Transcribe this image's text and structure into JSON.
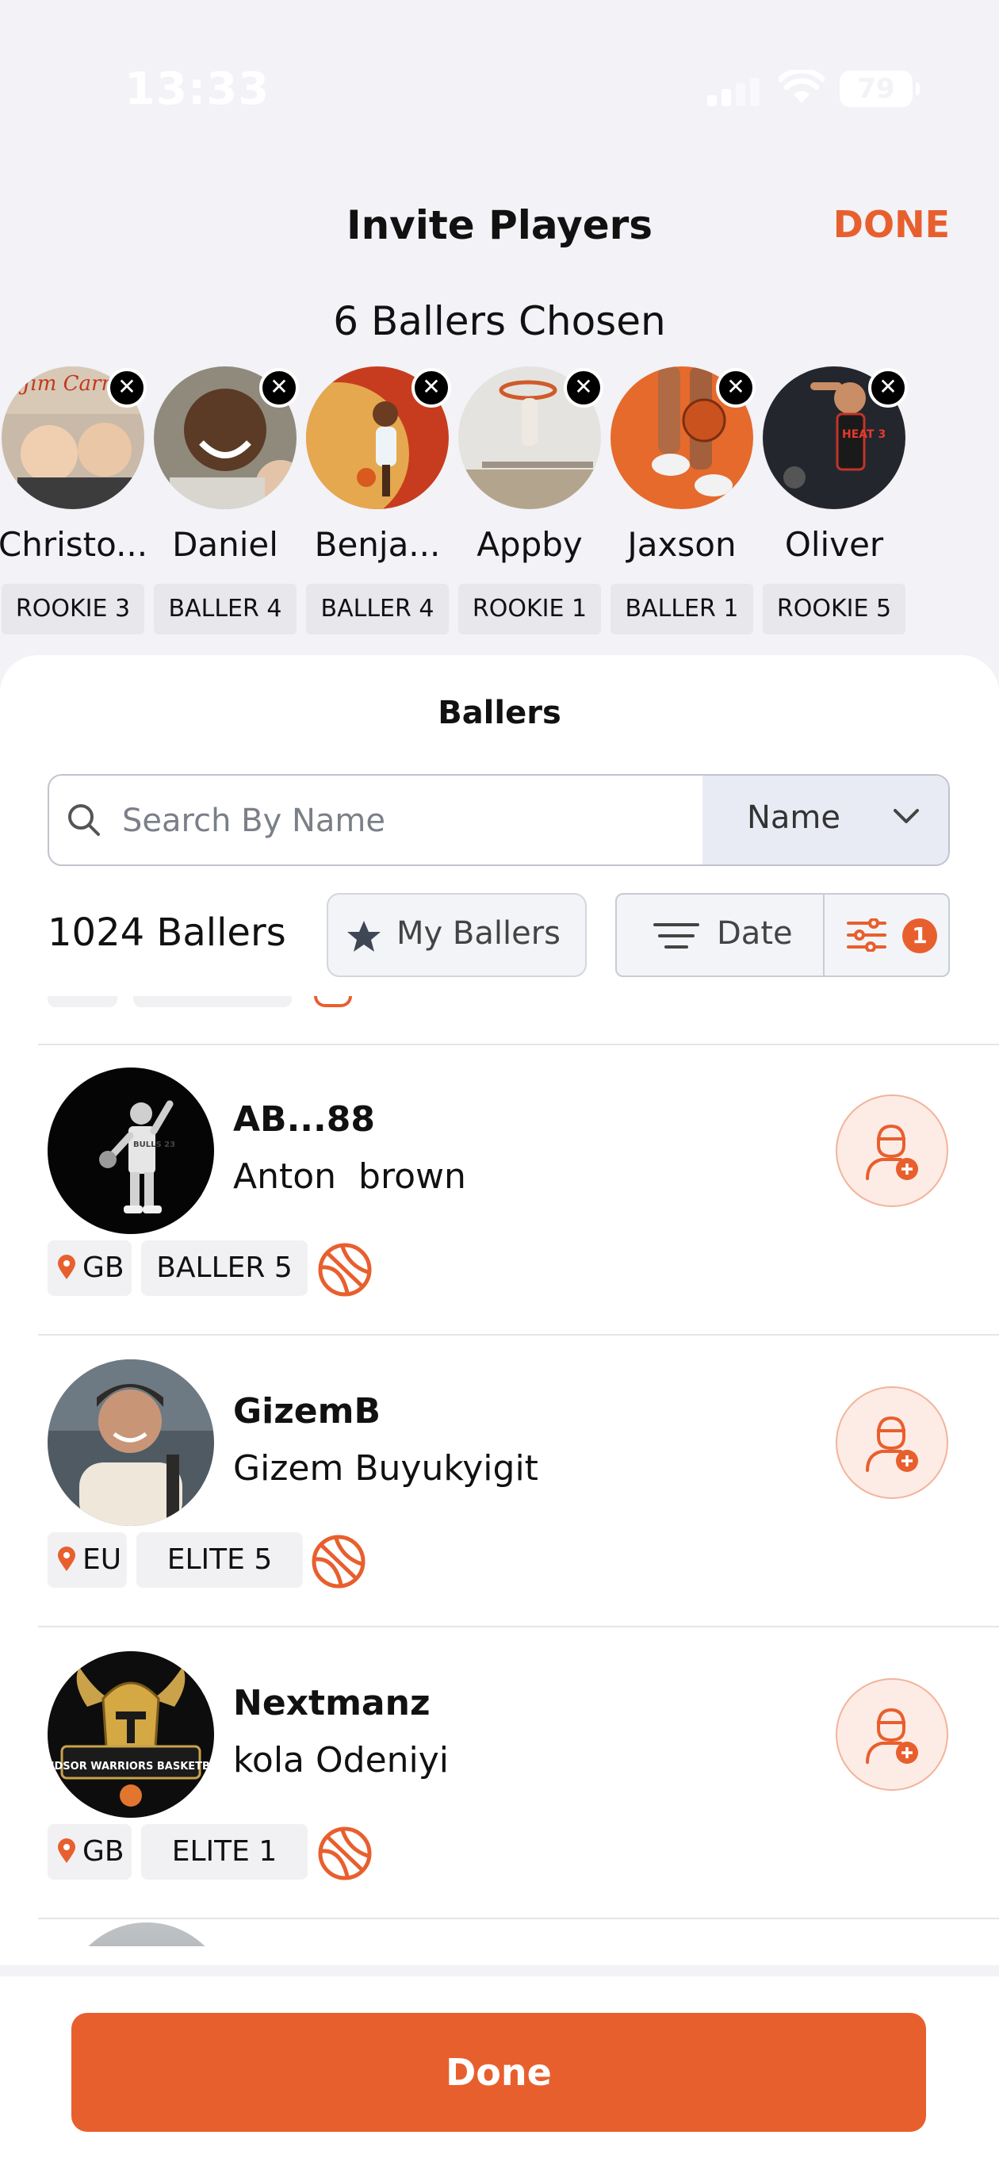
{
  "status_bar": {
    "time": "13:33",
    "battery": "79"
  },
  "header": {
    "title": "Invite Players",
    "done_label": "DONE"
  },
  "chosen_summary": "6 Ballers Chosen",
  "chosen_players": [
    {
      "name": "Christo...",
      "badge": "ROOKIE 3"
    },
    {
      "name": "Daniel",
      "badge": "BALLER 4"
    },
    {
      "name": "Benja...",
      "badge": "BALLER 4"
    },
    {
      "name": "Appby",
      "badge": "ROOKIE 1"
    },
    {
      "name": "Jaxson",
      "badge": "BALLER 1"
    },
    {
      "name": "Oliver",
      "badge": "ROOKIE 5"
    }
  ],
  "ballers_section": {
    "title": "Ballers",
    "search": {
      "placeholder": "Search By Name",
      "value": ""
    },
    "search_by": "Name",
    "count": "1024 Ballers",
    "my_ballers_label": "My Ballers",
    "sort_label": "Date",
    "filter_count": "1"
  },
  "players": [
    {
      "handle": "AB...88",
      "name": "Anton  brown",
      "location": "GB",
      "level": "BALLER 5"
    },
    {
      "handle": "GizemB",
      "name": "Gizem Buyukyigit",
      "location": "EU",
      "level": "ELITE 5"
    },
    {
      "handle": "Nextmanz",
      "name": "kola Odeniyi",
      "location": "GB",
      "level": "ELITE 1"
    }
  ],
  "avatar_texts": {
    "jim_carrey": "Jim Carrey",
    "bulls_jersey": "BULLS 23",
    "heat_jersey": "HEAT 3",
    "warriors_logo": "WINDSOR WARRIORS BASKETBALL"
  },
  "footer": {
    "done_button": "Done"
  },
  "colors": {
    "accent": "#E85F2E",
    "background": "#F2F2F7",
    "chip": "#F1F1F4"
  }
}
